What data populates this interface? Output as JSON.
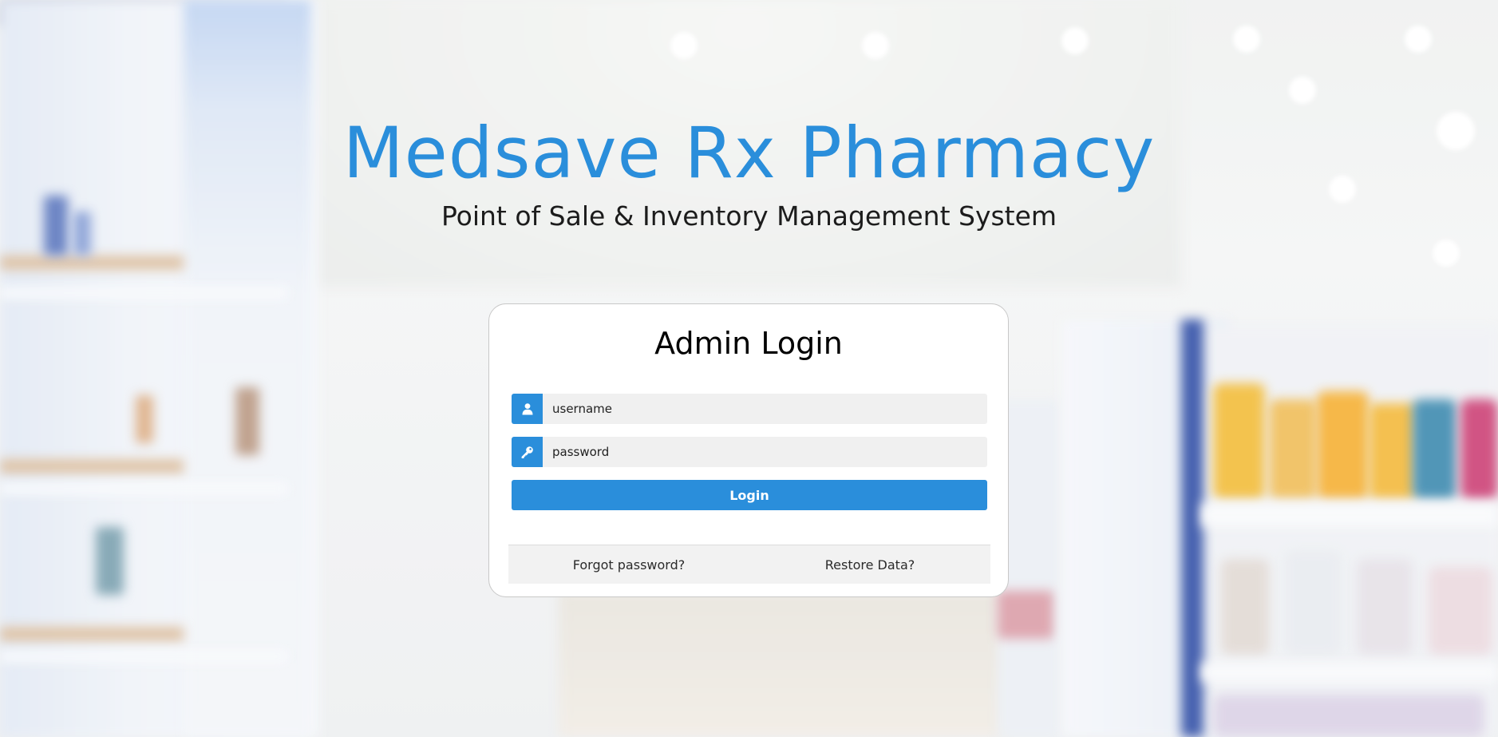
{
  "brand": {
    "title": "Medsave Rx Pharmacy",
    "subtitle": "Point of Sale & Inventory Management System"
  },
  "login": {
    "heading": "Admin Login",
    "username": {
      "placeholder": "username",
      "value": "",
      "icon": "user-icon"
    },
    "password": {
      "placeholder": "password",
      "value": "",
      "icon": "key-icon"
    },
    "submit_label": "Login",
    "links": {
      "forgot": "Forgot password?",
      "restore": "Restore Data?"
    }
  },
  "colors": {
    "accent": "#2a8edb",
    "card_bg": "#ffffff",
    "input_bg": "#f0f0f0",
    "footer_bg": "#f2f2f2"
  }
}
